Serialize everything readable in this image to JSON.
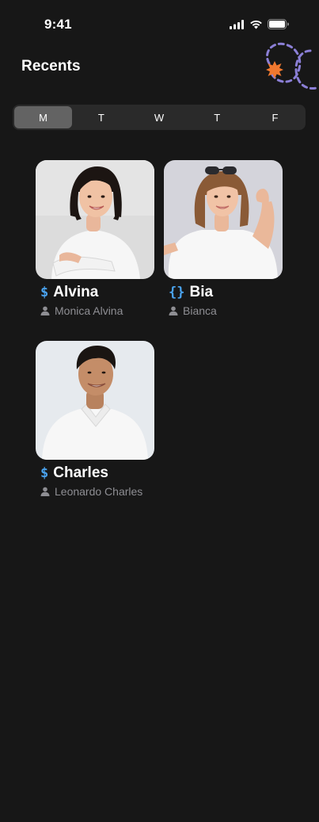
{
  "status_bar": {
    "time": "9:41",
    "icons": [
      "cellular-signal-icon",
      "wifi-icon",
      "battery-icon"
    ]
  },
  "header": {
    "title": "Recents"
  },
  "day_tabs": {
    "items": [
      {
        "label": "M",
        "active": true
      },
      {
        "label": "T",
        "active": false
      },
      {
        "label": "W",
        "active": false
      },
      {
        "label": "T",
        "active": false
      },
      {
        "label": "F",
        "active": false
      }
    ]
  },
  "cards": [
    {
      "name": "Alvina",
      "owner": "Monica Alvina",
      "type_icon": "$",
      "icon_name": "dollar-icon"
    },
    {
      "name": "Bia",
      "owner": "Bianca",
      "type_icon": "{}",
      "icon_name": "braces-icon"
    },
    {
      "name": "Charles",
      "owner": "Leonardo Charles",
      "type_icon": "$",
      "icon_name": "dollar-icon"
    }
  ],
  "colors": {
    "background": "#171717",
    "accent_blue": "#4aa3ef",
    "accent_orange": "#f0782f",
    "accent_purple": "#8b7fd6",
    "active_tab": "#636363",
    "secondary_text": "#8e8e93"
  }
}
